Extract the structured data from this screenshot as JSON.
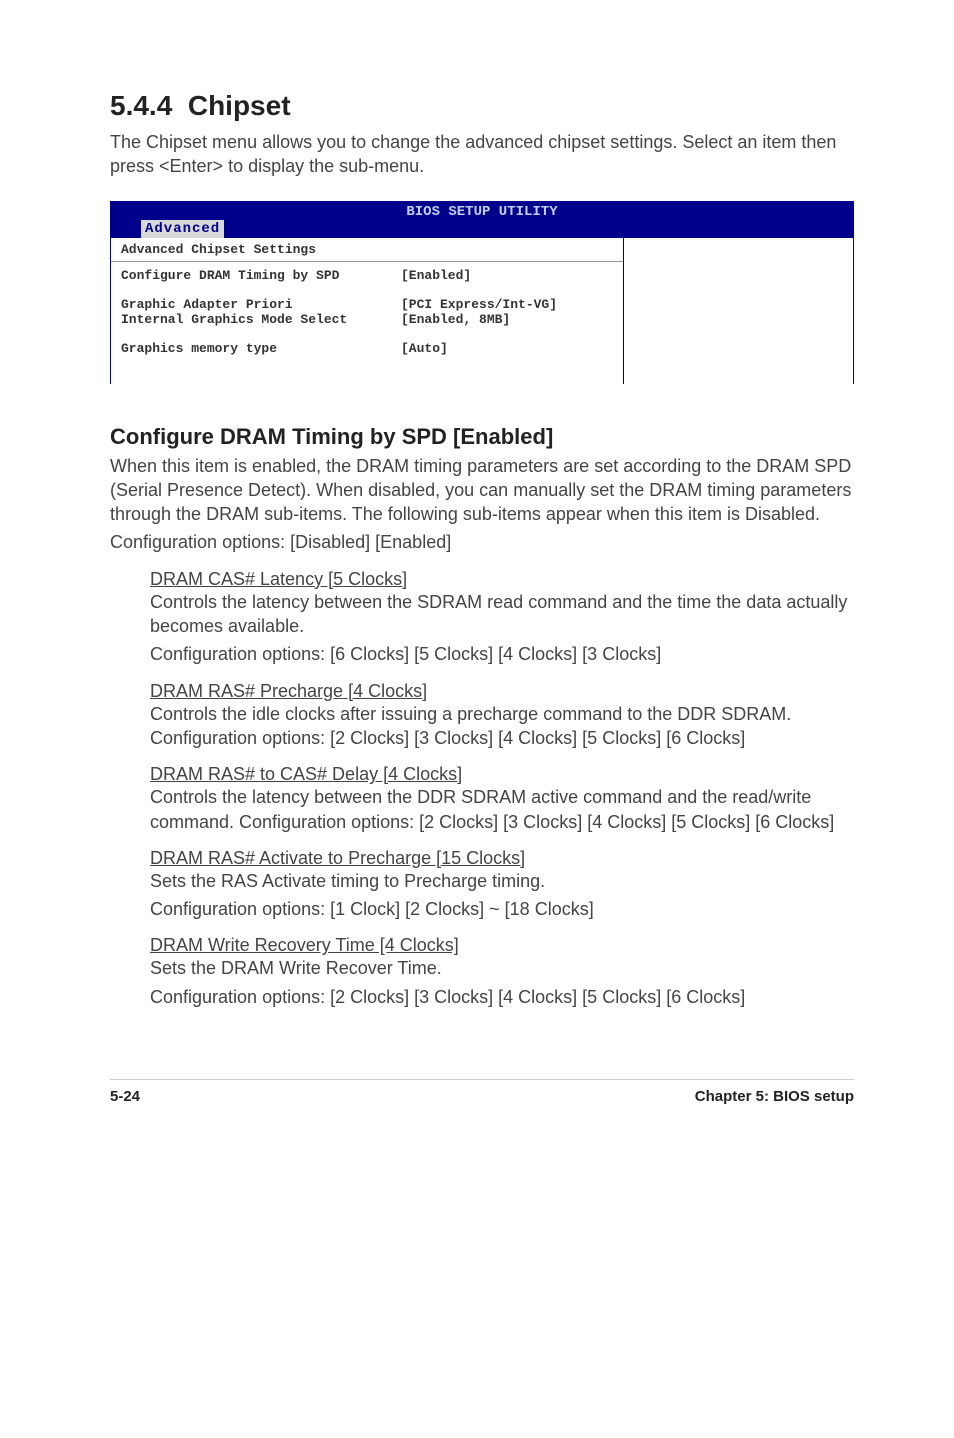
{
  "section": {
    "number": "5.4.4",
    "title": "Chipset"
  },
  "intro": "The Chipset menu allows you to change the advanced chipset settings. Select an item then press <Enter> to display the sub-menu.",
  "bios": {
    "utility_title": "BIOS SETUP UTILITY",
    "tab": "Advanced",
    "section_header": "Advanced Chipset Settings",
    "rows": [
      {
        "label": "Configure DRAM Timing by SPD",
        "value": "[Enabled]"
      },
      {
        "label": "Graphic Adapter Priori",
        "value": "[PCI Express/Int-VG]"
      },
      {
        "label": "Internal Graphics Mode Select",
        "value": "[Enabled, 8MB]"
      },
      {
        "label": "Graphics memory type",
        "value": "[Auto]"
      }
    ]
  },
  "config_dram": {
    "heading": "Configure DRAM Timing by SPD [Enabled]",
    "body": "When this item is enabled, the DRAM timing parameters are set according to the DRAM SPD (Serial Presence Detect). When disabled, you can manually set the DRAM timing parameters through the DRAM sub-items. The following sub-items appear when this item is Disabled.",
    "options": "Configuration options: [Disabled] [Enabled]"
  },
  "subitems": [
    {
      "title": "DRAM CAS# Latency [5 Clocks]",
      "lines": [
        "Controls the latency between the SDRAM read command and the time the data actually becomes available.",
        "Configuration options: [6 Clocks] [5 Clocks] [4 Clocks] [3 Clocks]"
      ]
    },
    {
      "title": "DRAM RAS# Precharge [4 Clocks]",
      "lines": [
        "Controls the idle clocks after issuing a precharge command to the DDR SDRAM. Configuration options: [2 Clocks] [3 Clocks] [4 Clocks] [5 Clocks] [6 Clocks]"
      ]
    },
    {
      "title": "DRAM RAS# to CAS# Delay [4 Clocks]",
      "lines": [
        "Controls the latency between the DDR SDRAM active command and the read/write command. Configuration options: [2 Clocks] [3 Clocks] [4 Clocks] [5 Clocks] [6 Clocks]"
      ]
    },
    {
      "title": "DRAM RAS# Activate to Precharge [15 Clocks]",
      "lines": [
        "Sets the RAS Activate timing to Precharge timing.",
        "Configuration options: [1 Clock] [2 Clocks] ~ [18 Clocks]"
      ]
    },
    {
      "title": "DRAM Write Recovery Time [4 Clocks]",
      "lines": [
        "Sets the DRAM Write Recover Time.",
        "Configuration options: [2 Clocks] [3 Clocks] [4 Clocks] [5 Clocks] [6 Clocks]"
      ]
    }
  ],
  "footer": {
    "page": "5-24",
    "chapter": "Chapter 5: BIOS setup"
  }
}
